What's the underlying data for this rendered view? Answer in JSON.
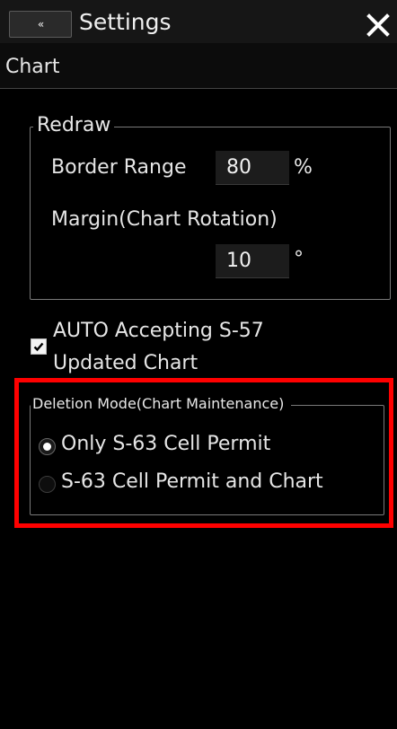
{
  "titlebar": {
    "collapse_label": "«",
    "title": "Settings",
    "close_label": "✕"
  },
  "section": {
    "title": "Chart"
  },
  "redraw": {
    "legend": "Redraw",
    "border_range_label": "Border Range",
    "border_range_value": "80",
    "border_range_unit": "%",
    "margin_label": "Margin(Chart Rotation)",
    "margin_value": "10",
    "margin_unit": "°"
  },
  "auto_accept": {
    "checked": true,
    "label_line1": "AUTO Accepting S-57",
    "label_line2": "Updated Chart"
  },
  "deletion_mode": {
    "legend": "Deletion Mode(Chart Maintenance)",
    "options": [
      {
        "label": "Only S-63 Cell Permit",
        "selected": true
      },
      {
        "label": "S-63 Cell Permit and Chart",
        "selected": false
      }
    ]
  },
  "colors": {
    "background": "#000000",
    "highlight": "#ff0000",
    "text": "#e6e6e6"
  }
}
